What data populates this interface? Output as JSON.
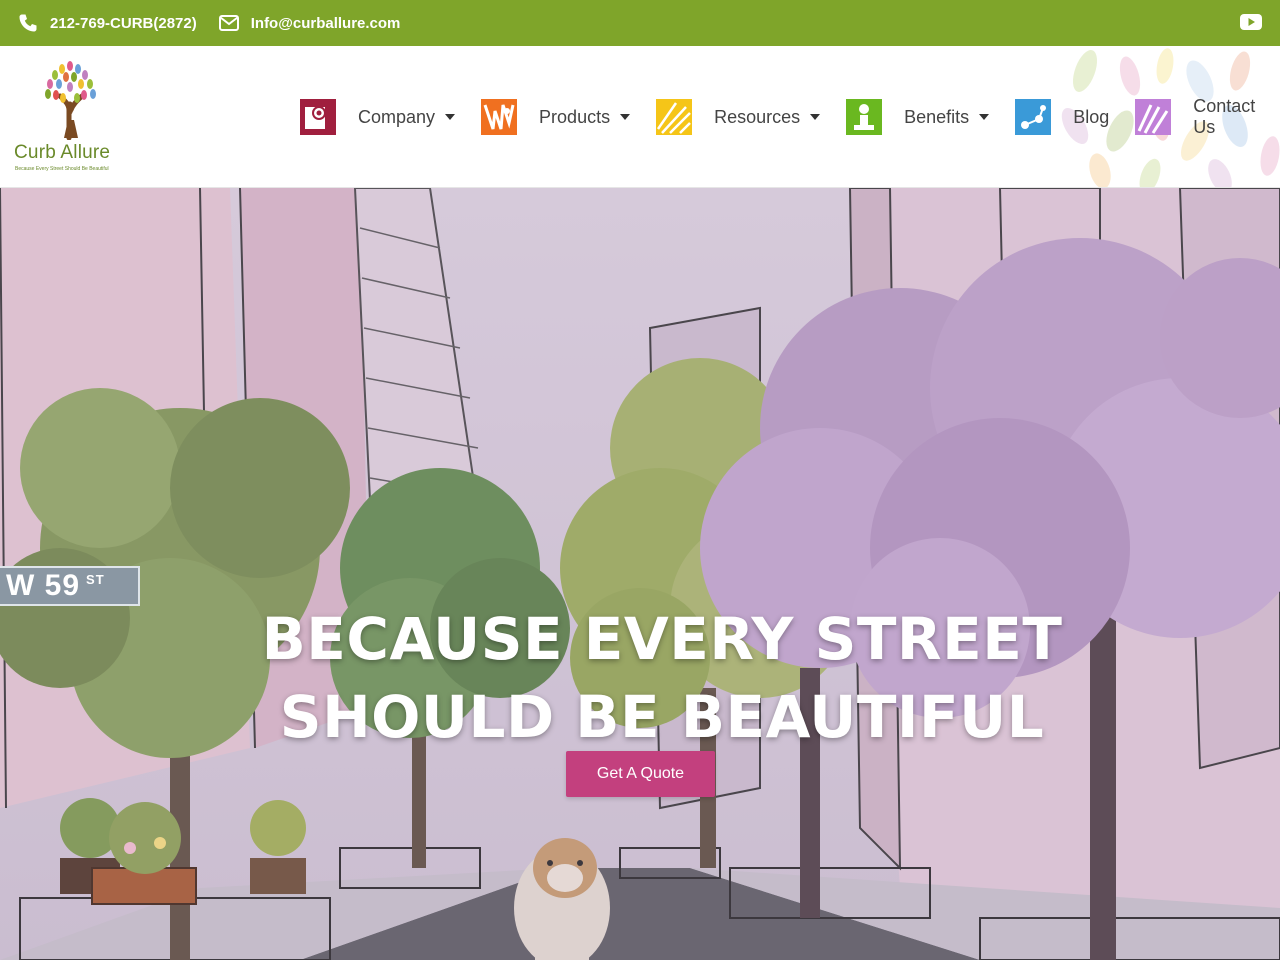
{
  "topbar": {
    "phone": "212-769-CURB(2872)",
    "email": "Info@curballure.com",
    "icons": [
      "phone-icon",
      "envelope-icon",
      "youtube-icon"
    ]
  },
  "logo": {
    "brand": "Curb Allure",
    "tagline": "Because Every Street Should Be Beautiful"
  },
  "nav": {
    "items": [
      {
        "label": "Company",
        "icon": "company-icon",
        "dropdown": true
      },
      {
        "label": "Products",
        "icon": "products-icon",
        "dropdown": true
      },
      {
        "label": "Resources",
        "icon": "resources-icon",
        "dropdown": true
      },
      {
        "label": "Benefits",
        "icon": "benefits-icon",
        "dropdown": true
      },
      {
        "label": "Blog",
        "icon": "blog-icon",
        "dropdown": false
      },
      {
        "label": "Contact Us",
        "icon": "contact-icon",
        "dropdown": false
      }
    ]
  },
  "hero": {
    "headline_line1": "BECAUSE EVERY STREET",
    "headline_line2": "SHOULD BE BEAUTIFUL",
    "cta": "Get A Quote",
    "street_sign": "W 59",
    "street_sign_suffix": "ST"
  },
  "colors": {
    "topbar": "#7fa52a",
    "cta": "#c3407e",
    "brand_green": "#6a8a2a"
  }
}
